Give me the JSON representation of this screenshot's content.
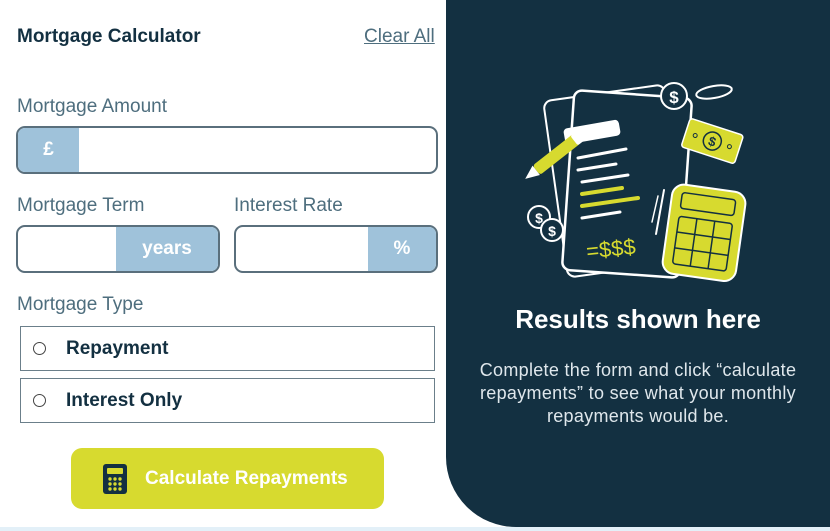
{
  "form": {
    "title": "Mortgage Calculator",
    "clear_label": "Clear All",
    "amount": {
      "label": "Mortgage Amount",
      "prefix": "£",
      "value": ""
    },
    "term": {
      "label": "Mortgage Term",
      "suffix": "years",
      "value": ""
    },
    "rate": {
      "label": "Interest Rate",
      "suffix": "%",
      "value": ""
    },
    "type": {
      "label": "Mortgage Type",
      "options": [
        {
          "label": "Repayment",
          "selected": false
        },
        {
          "label": "Interest Only",
          "selected": false
        }
      ]
    },
    "submit_label": "Calculate Repayments",
    "submit_icon": "calculator-icon"
  },
  "results": {
    "illustration": "calculator-illustration",
    "illustration_text": "=$$$",
    "title": "Results shown here",
    "text": "Complete the form and click “calculate repayments” to see what your monthly repayments would be."
  },
  "colors": {
    "dark": "#133041",
    "lime": "#d7da2f",
    "addon": "#9fc2da",
    "muted": "#4e6e7e",
    "background": "#e3f0f8"
  }
}
